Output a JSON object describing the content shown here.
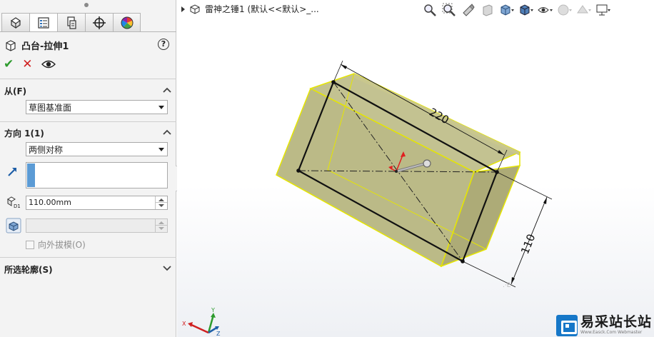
{
  "tabs": [
    {
      "name": "feature-manager",
      "icon": "feature-tree-icon"
    },
    {
      "name": "property-manager",
      "icon": "property-list-icon",
      "active": true
    },
    {
      "name": "configuration-manager",
      "icon": "configuration-icon"
    },
    {
      "name": "dimxpert-manager",
      "icon": "crosshair-icon"
    },
    {
      "name": "display-manager",
      "icon": "color-wheel-icon"
    }
  ],
  "feature": {
    "title": "凸台-拉伸1",
    "help_label": "?"
  },
  "from_section": {
    "heading": "从(F)",
    "selected": "草图基准面"
  },
  "direction_section": {
    "heading": "方向 1(1)",
    "end_condition": "两侧对称",
    "depth_value": "110.00mm",
    "draft_value": "",
    "draft_outward_label": "向外拔模(O)"
  },
  "contours_section": {
    "heading": "所选轮廓(S)"
  },
  "viewport": {
    "breadcrumb": "雷神之锤1  (默认<<默认>_..."
  },
  "dimensions": {
    "length": "220",
    "width": "110"
  },
  "triad": {
    "x": "X",
    "y": "Y",
    "z": "Z"
  },
  "colors": {
    "solid_fill": "#b9b77e",
    "solid_edge": "#e6e600",
    "accent": "#5b9bd5"
  },
  "watermark": {
    "title": "易采站长站",
    "subtitle": "Www.Easck.Com  Webmaster"
  }
}
